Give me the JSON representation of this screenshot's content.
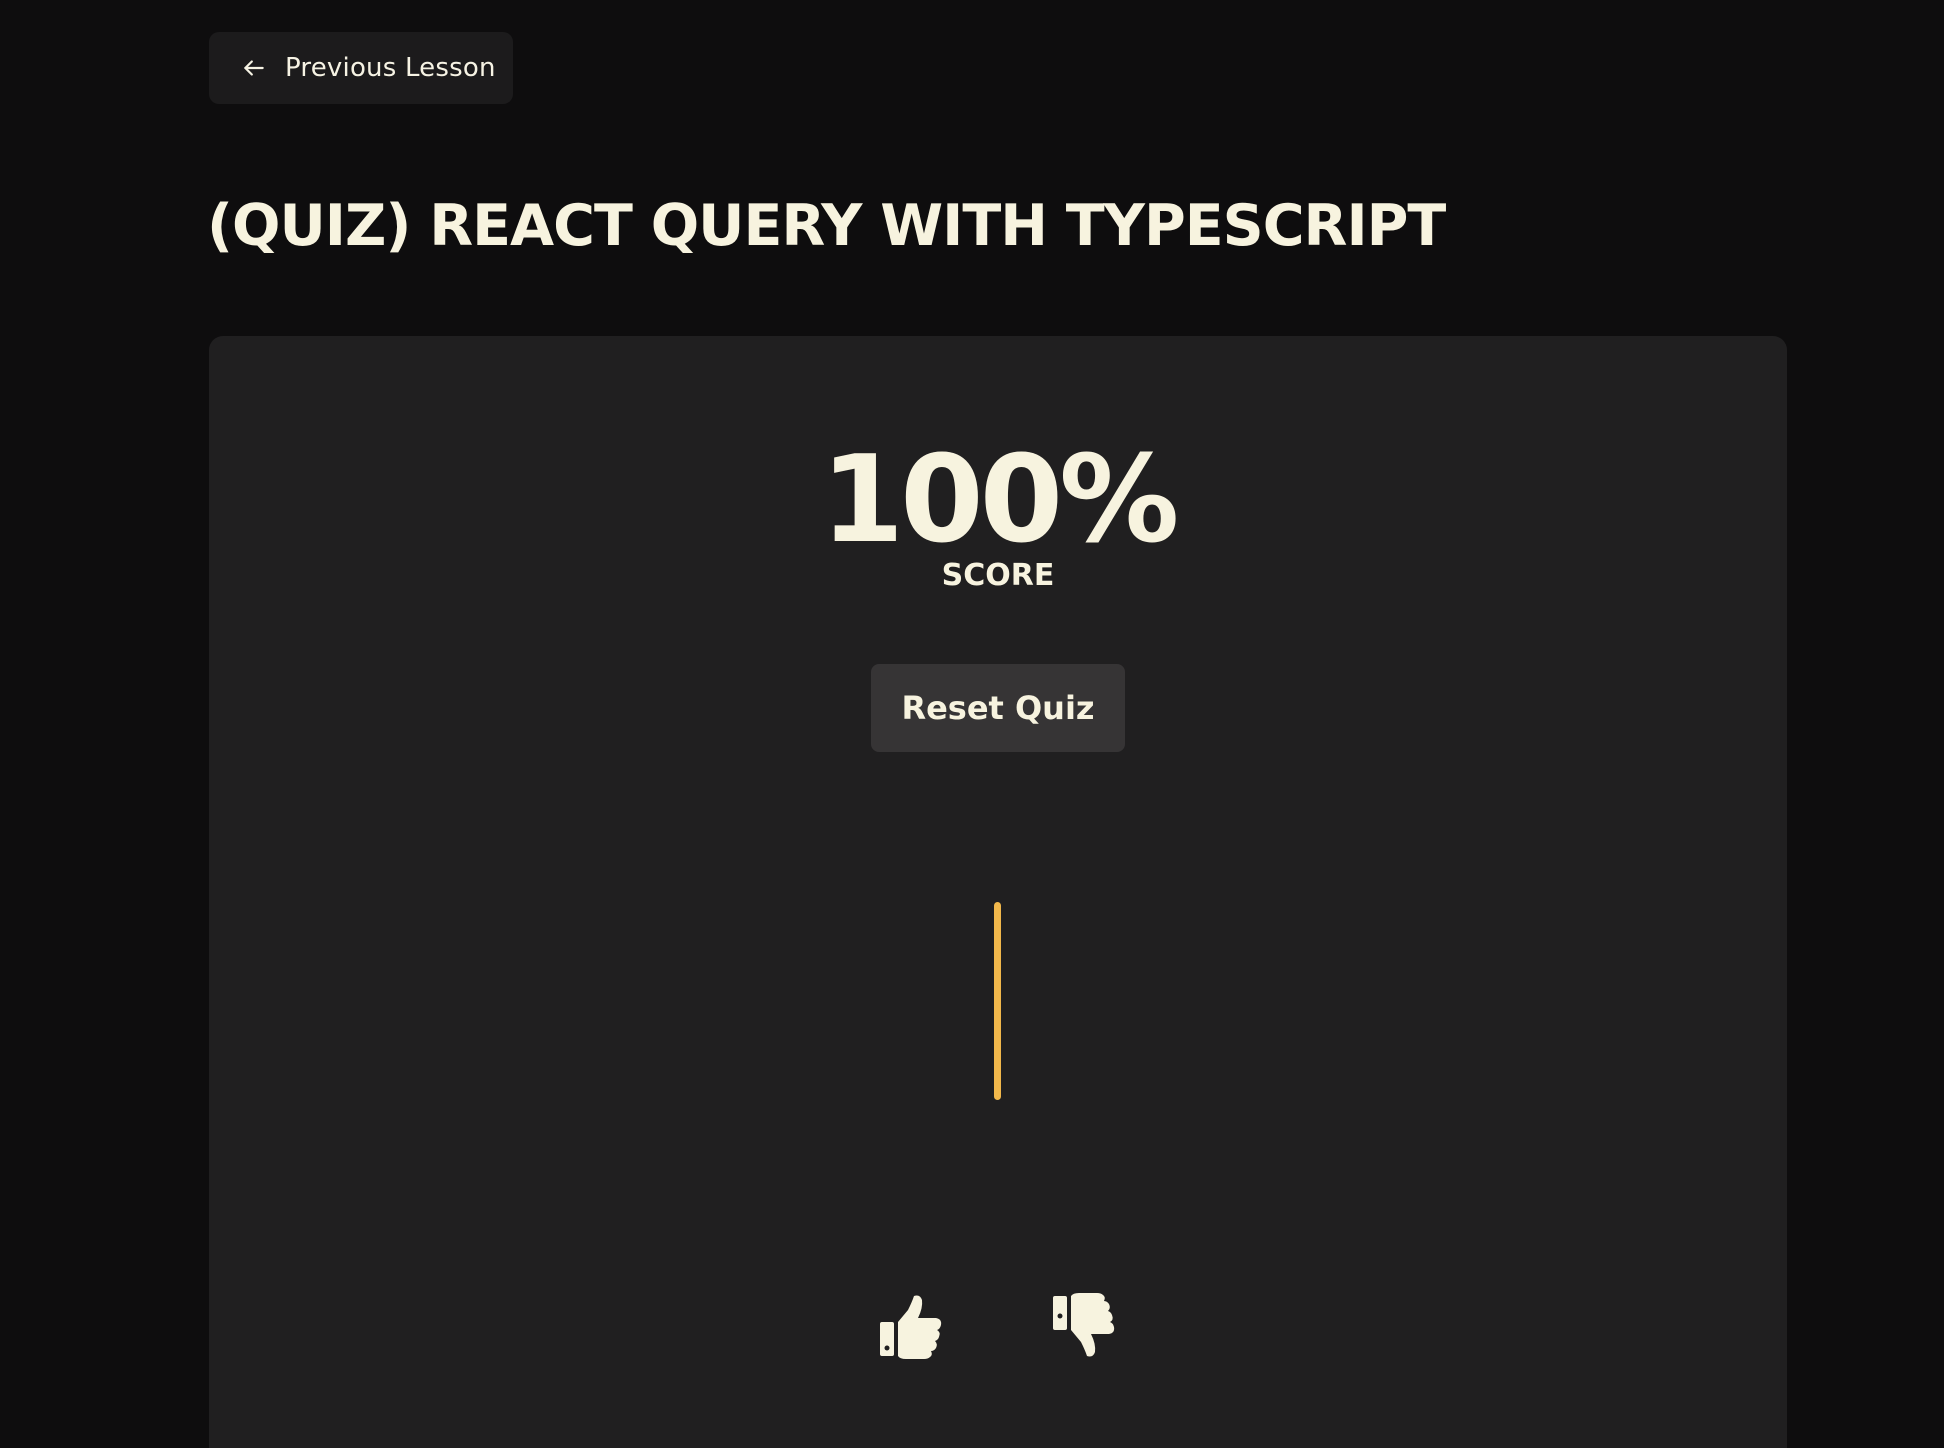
{
  "nav": {
    "previous_label": "Previous Lesson",
    "previous_icon": "arrow-left-icon"
  },
  "lesson": {
    "title": "(QUIZ) REACT QUERY WITH TYPESCRIPT"
  },
  "quiz": {
    "score": "100%",
    "score_label": "SCORE",
    "score_fraction": 1.0,
    "reset_label": "Reset Quiz"
  },
  "feedback": {
    "like_icon": "thumbs-up-icon",
    "dislike_icon": "thumbs-down-icon"
  },
  "colors": {
    "background": "#0e0d0e",
    "card": "#201f20",
    "text": "#f7f3df",
    "button": "#363435",
    "accent": "#f2b84b"
  }
}
